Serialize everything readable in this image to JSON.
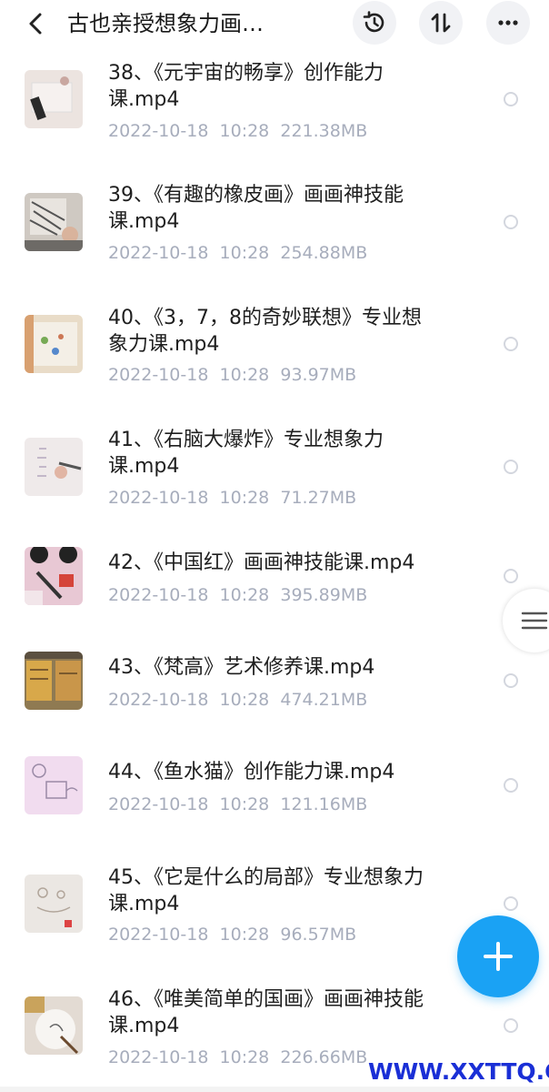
{
  "header": {
    "title": "古也亲授想象力画…",
    "back_icon": "chevron-left-icon",
    "history_icon": "history-icon",
    "sort_icon": "sort-icon",
    "more_icon": "more-dots-icon"
  },
  "files": [
    {
      "line1": "38、《元宇宙的畅享》创作能力",
      "line2": "课.mp4",
      "date": "2022-10-18",
      "time": "10:28",
      "size": "221.38MB"
    },
    {
      "line1": "39、《有趣的橡皮画》画画神技能",
      "line2": "课.mp4",
      "date": "2022-10-18",
      "time": "10:28",
      "size": "254.88MB"
    },
    {
      "line1": "40、《3，7，8的奇妙联想》专业想",
      "line2": "象力课.mp4",
      "date": "2022-10-18",
      "time": "10:28",
      "size": "93.97MB"
    },
    {
      "line1": "41、《右脑大爆炸》专业想象力",
      "line2": "课.mp4",
      "date": "2022-10-18",
      "time": "10:28",
      "size": "71.27MB"
    },
    {
      "line1": "42、《中国红》画画神技能课.mp4",
      "line2": "",
      "date": "2022-10-18",
      "time": "10:28",
      "size": "395.89MB"
    },
    {
      "line1": "43、《梵高》艺术修养课.mp4",
      "line2": "",
      "date": "2022-10-18",
      "time": "10:28",
      "size": "474.21MB"
    },
    {
      "line1": "44、《鱼水猫》创作能力课.mp4",
      "line2": "",
      "date": "2022-10-18",
      "time": "10:28",
      "size": "121.16MB"
    },
    {
      "line1": "45、《它是什么的局部》专业想象力",
      "line2": "课.mp4",
      "date": "2022-10-18",
      "time": "10:28",
      "size": "96.57MB"
    },
    {
      "line1": "46、《唯美简单的国画》画画神技能",
      "line2": "课.mp4",
      "date": "2022-10-18",
      "time": "10:28",
      "size": "226.66MB"
    }
  ],
  "watermark": "WWW.XXTTQ.COM",
  "colors": {
    "accent": "#1aa2f4",
    "meta_text": "#a7adbc",
    "watermark": "#1a2fd6"
  }
}
